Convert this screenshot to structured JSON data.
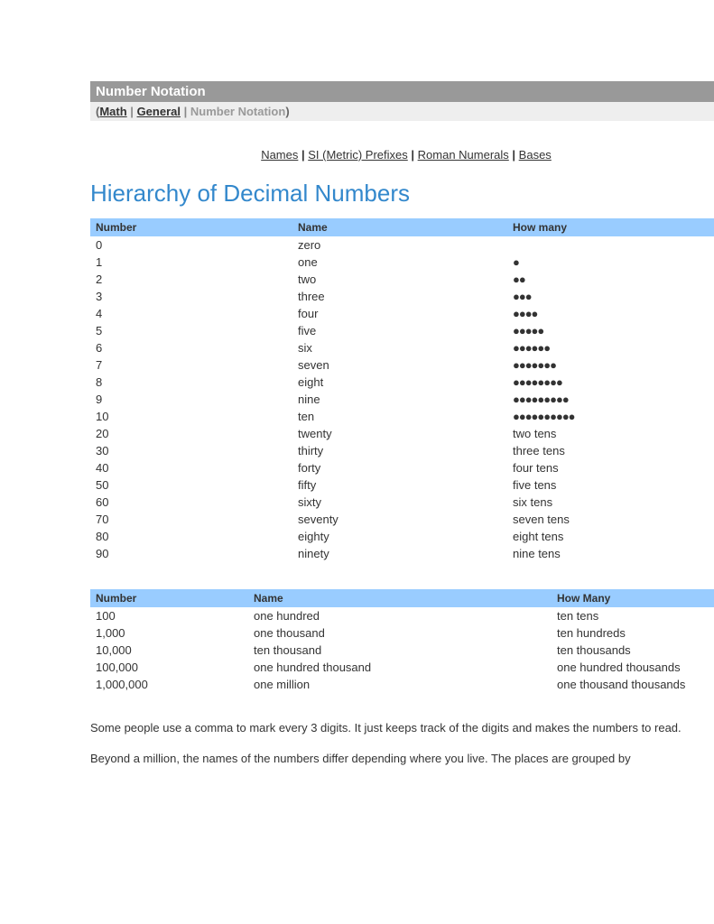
{
  "header": {
    "title": "Number Notation",
    "breadcrumb": {
      "open": "(",
      "math": "Math",
      "general": "General",
      "current": "Number Notation",
      "close": ")",
      "sep": " | "
    }
  },
  "top_links": {
    "names": "Names",
    "si": "SI (Metric) Prefixes",
    "roman": "Roman Numerals",
    "bases": "Bases",
    "sep": " | "
  },
  "section_title": "Hierarchy of Decimal Numbers",
  "table1": {
    "headers": {
      "number": "Number",
      "name": "Name",
      "howmany": "How many"
    },
    "rows": [
      {
        "number": "0",
        "name": "zero",
        "howmany": ""
      },
      {
        "number": "1",
        "name": "one",
        "howmany": "●"
      },
      {
        "number": "2",
        "name": "two",
        "howmany": "●●"
      },
      {
        "number": "3",
        "name": "three",
        "howmany": "●●●"
      },
      {
        "number": "4",
        "name": "four",
        "howmany": "●●●●"
      },
      {
        "number": "5",
        "name": "five",
        "howmany": "●●●●●"
      },
      {
        "number": "6",
        "name": "six",
        "howmany": "●●●●●●"
      },
      {
        "number": "7",
        "name": "seven",
        "howmany": "●●●●●●●"
      },
      {
        "number": "8",
        "name": "eight",
        "howmany": "●●●●●●●●"
      },
      {
        "number": "9",
        "name": "nine",
        "howmany": "●●●●●●●●●"
      },
      {
        "number": "10",
        "name": "ten",
        "howmany": "●●●●●●●●●●"
      },
      {
        "number": "20",
        "name": "twenty",
        "howmany": "two tens"
      },
      {
        "number": "30",
        "name": "thirty",
        "howmany": "three tens"
      },
      {
        "number": "40",
        "name": "forty",
        "howmany": "four tens"
      },
      {
        "number": "50",
        "name": "fifty",
        "howmany": "five tens"
      },
      {
        "number": "60",
        "name": "sixty",
        "howmany": "six tens"
      },
      {
        "number": "70",
        "name": "seventy",
        "howmany": "seven tens"
      },
      {
        "number": "80",
        "name": "eighty",
        "howmany": "eight tens"
      },
      {
        "number": "90",
        "name": "ninety",
        "howmany": "nine tens"
      }
    ]
  },
  "table2": {
    "headers": {
      "number": "Number",
      "name": "Name",
      "howmany": "How Many"
    },
    "rows": [
      {
        "number": "100",
        "name": "one hundred",
        "howmany": "ten tens"
      },
      {
        "number": "1,000",
        "name": "one thousand",
        "howmany": "ten hundreds"
      },
      {
        "number": "10,000",
        "name": "ten thousand",
        "howmany": "ten thousands"
      },
      {
        "number": "100,000",
        "name": "one hundred thousand",
        "howmany": "one hundred thousands"
      },
      {
        "number": "1,000,000",
        "name": "one million",
        "howmany": "one thousand thousands"
      }
    ]
  },
  "paragraphs": {
    "p1": "Some people use a comma to mark every 3 digits. It just keeps track of the digits and makes the numbers to read.",
    "p2": "Beyond a million, the names of the numbers differ depending where you live. The places are grouped by"
  }
}
